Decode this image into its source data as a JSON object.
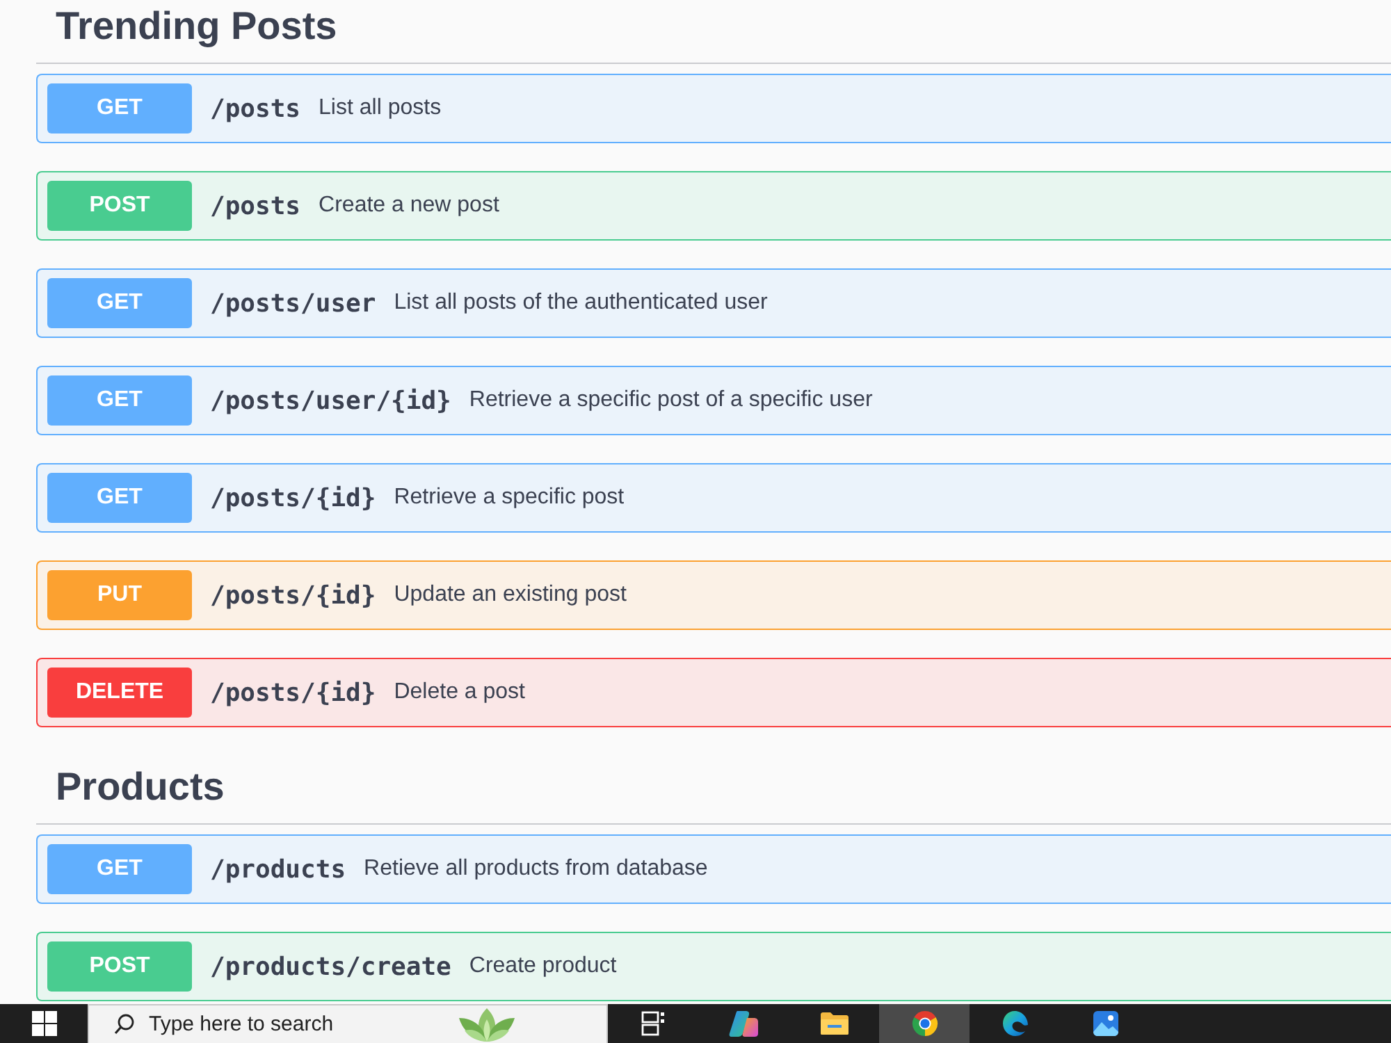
{
  "sections": [
    {
      "title": "Trending Posts",
      "operations": [
        {
          "kind": "get",
          "method": "GET",
          "path": "/posts",
          "summary": "List all posts"
        },
        {
          "kind": "post",
          "method": "POST",
          "path": "/posts",
          "summary": "Create a new post"
        },
        {
          "kind": "get",
          "method": "GET",
          "path": "/posts/user",
          "summary": "List all posts of the authenticated user"
        },
        {
          "kind": "get",
          "method": "GET",
          "path": "/posts/user/{id}",
          "summary": "Retrieve a specific post of a specific user"
        },
        {
          "kind": "get",
          "method": "GET",
          "path": "/posts/{id}",
          "summary": "Retrieve a specific post"
        },
        {
          "kind": "put",
          "method": "PUT",
          "path": "/posts/{id}",
          "summary": "Update an existing post"
        },
        {
          "kind": "delete",
          "method": "DELETE",
          "path": "/posts/{id}",
          "summary": "Delete a post"
        }
      ]
    },
    {
      "title": "Products",
      "operations": [
        {
          "kind": "get",
          "method": "GET",
          "path": "/products",
          "summary": "Retieve all products from database"
        },
        {
          "kind": "post",
          "method": "POST",
          "path": "/products/create",
          "summary": "Create product"
        }
      ]
    }
  ],
  "taskbar": {
    "search": {
      "placeholder": "Type here to search"
    },
    "apps": [
      {
        "kind": "task-view",
        "selected": false
      },
      {
        "kind": "ribbon",
        "selected": false
      },
      {
        "kind": "folder",
        "selected": false
      },
      {
        "kind": "browser",
        "selected": true
      },
      {
        "kind": "wave",
        "selected": false
      },
      {
        "kind": "photo",
        "selected": false
      }
    ]
  }
}
